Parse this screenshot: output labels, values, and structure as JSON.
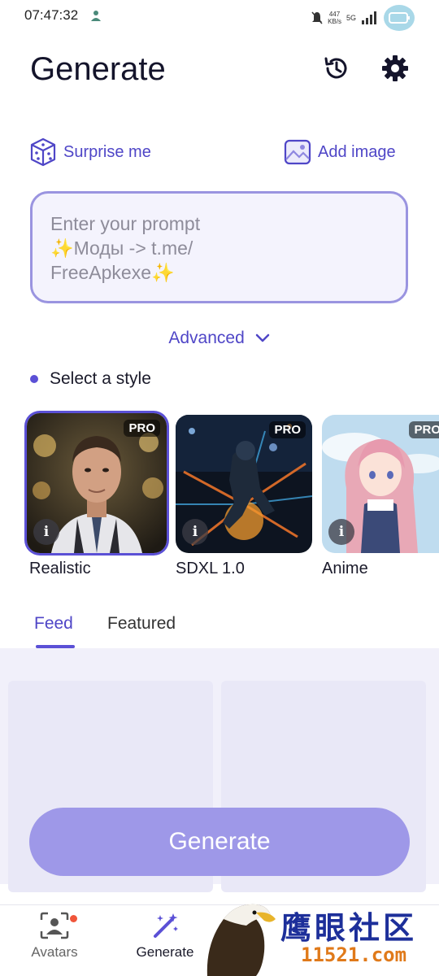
{
  "status_bar": {
    "time": "07:47:32",
    "net_speed_value": "447",
    "net_speed_unit": "KB/s",
    "signal_label": "5G"
  },
  "header": {
    "title": "Generate",
    "history_icon": "history-icon",
    "settings_icon": "gear-icon"
  },
  "actions": {
    "surprise_label": "Surprise me",
    "add_image_label": "Add image"
  },
  "prompt": {
    "placeholder": "Enter your prompt\n✨Моды -> t.me/\nFreeApkexe✨"
  },
  "advanced_label": "Advanced",
  "style_section": {
    "heading": "Select a style",
    "styles": [
      {
        "name": "Realistic",
        "badge": "PRO",
        "selected": true
      },
      {
        "name": "SDXL 1.0",
        "badge": "PRO",
        "selected": false
      },
      {
        "name": "Anime",
        "badge": "PRO",
        "selected": false
      }
    ],
    "info_glyph": "i"
  },
  "tabs": [
    {
      "label": "Feed",
      "active": true
    },
    {
      "label": "Featured",
      "active": false
    }
  ],
  "generate_button_label": "Generate",
  "bottom_nav": [
    {
      "label": "Avatars",
      "icon": "avatar-scan-icon"
    },
    {
      "label": "Generate",
      "icon": "magic-wand-icon"
    }
  ],
  "watermark": {
    "text": "鹰眼社区",
    "url": "11521.com"
  },
  "colors": {
    "accent": "#5b50d6",
    "accent_text": "#4f46c7",
    "prompt_border": "#9a94e0",
    "generate_button": "#9e98e8"
  }
}
